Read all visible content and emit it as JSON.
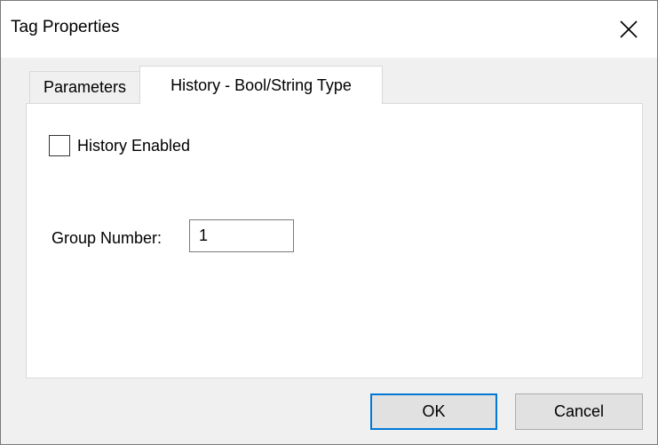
{
  "window": {
    "title": "Tag Properties",
    "close_icon": "close-icon"
  },
  "tabs": [
    {
      "label": "Parameters",
      "active": false
    },
    {
      "label": "History - Bool/String Type",
      "active": true
    }
  ],
  "history": {
    "enabled_label": "History Enabled",
    "enabled_checked": false,
    "group_number_label": "Group Number:",
    "group_number_value": "1"
  },
  "buttons": {
    "ok_label": "OK",
    "cancel_label": "Cancel"
  },
  "colors": {
    "focus_accent": "#0078d7",
    "dialog_background": "#f0f0f0",
    "panel_background": "#ffffff"
  }
}
